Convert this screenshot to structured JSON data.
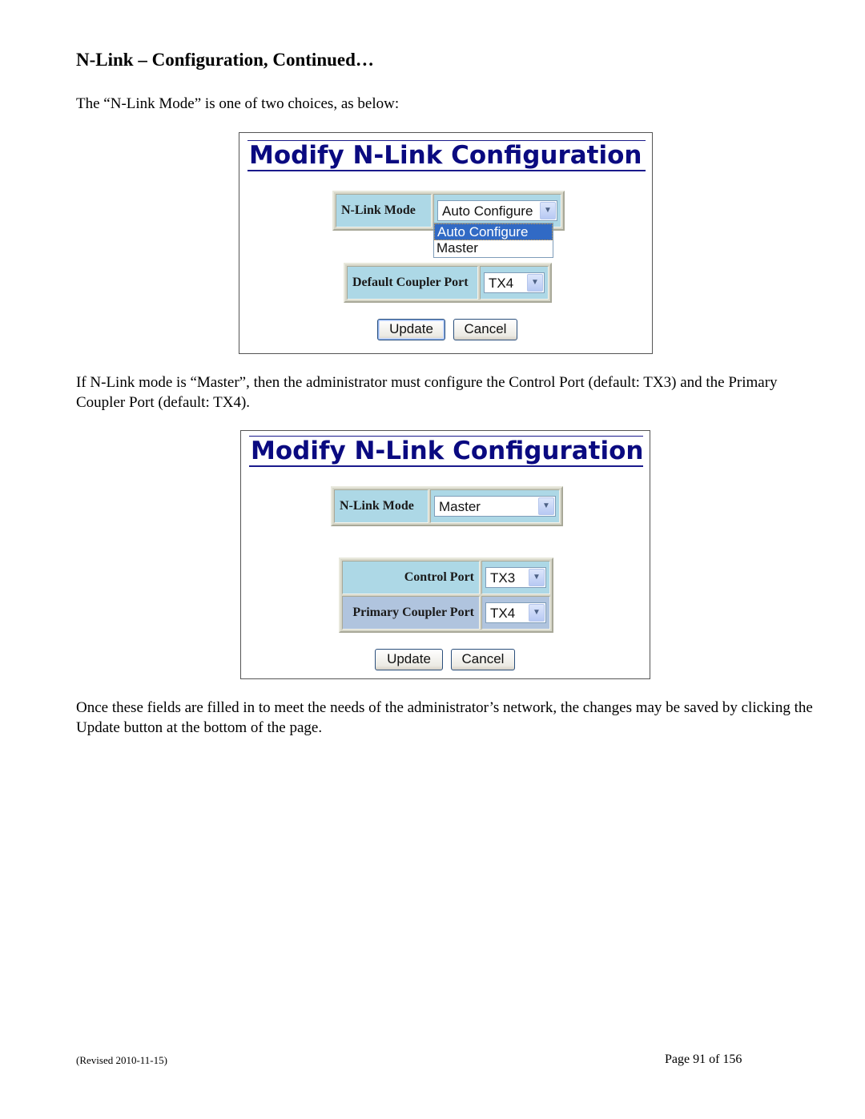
{
  "page": {
    "heading": "N-Link – Configuration, Continued…",
    "intro": "The “N-Link Mode” is one of two choices, as below:",
    "master_note": "If N-Link mode is “Master”, then the administrator must configure the Control Port (default: TX3) and the Primary Coupler Port (default: TX4).",
    "closing": "Once these fields are filled in to meet the needs of the administrator’s network, the changes may be saved by clicking the Update button at the bottom of the page.",
    "footer_revised": "(Revised 2010-11-15)",
    "footer_page": "Page 91 of 156"
  },
  "screenshot1": {
    "title": "Modify N-Link Configuration",
    "mode_label": "N-Link Mode",
    "mode_value": "Auto Configure",
    "mode_options": [
      "Auto Configure",
      "Master"
    ],
    "mode_highlighted": "Auto Configure",
    "coupler_label": "Default Coupler Port",
    "coupler_value": "TX4",
    "update_label": "Update",
    "cancel_label": "Cancel"
  },
  "screenshot2": {
    "title": "Modify N-Link Configuration",
    "mode_label": "N-Link Mode",
    "mode_value": "Master",
    "control_port_label": "Control Port",
    "control_port_value": "TX3",
    "primary_coupler_label": "Primary Coupler Port",
    "primary_coupler_value": "TX4",
    "update_label": "Update",
    "cancel_label": "Cancel"
  },
  "icons": {
    "dropdown_arrow": "chevron-down-icon",
    "arrow_glyph": "▼"
  }
}
